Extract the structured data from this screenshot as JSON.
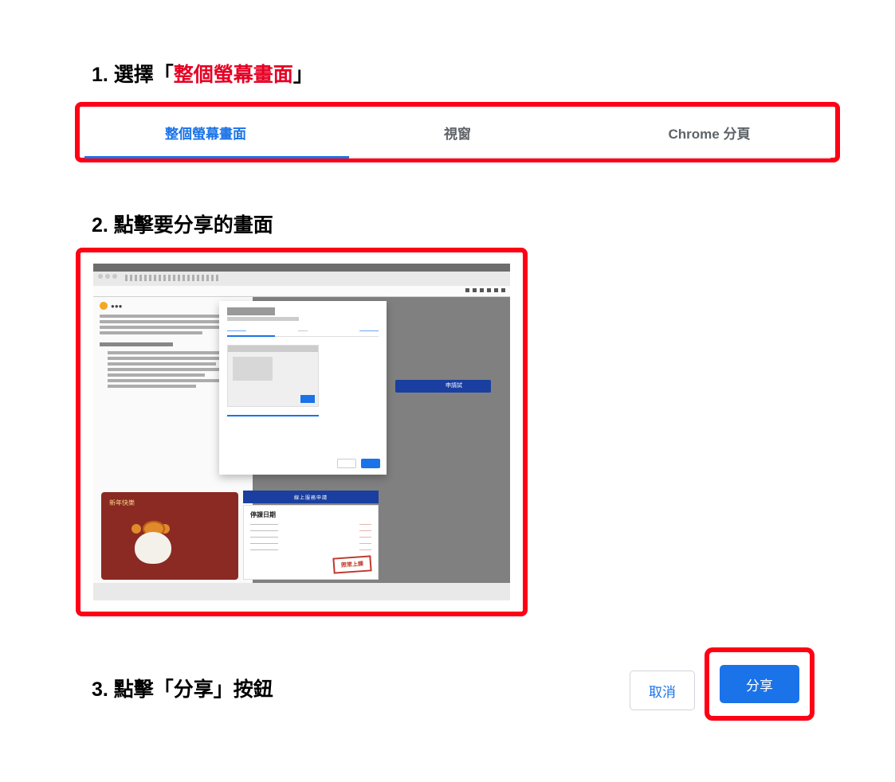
{
  "step1": {
    "prefix": "1.  選擇「",
    "highlight": "整個螢幕畫面",
    "suffix": "」"
  },
  "tabs": {
    "active": "整個螢幕畫面",
    "window": "視窗",
    "chrome_tab": "Chrome 分頁"
  },
  "step2": {
    "text": "2.  點擊要分享的畫面"
  },
  "preview": {
    "greeting": "新年快樂",
    "right_button": "申請試",
    "blue_strip": "線上服務申請",
    "notice_title": "停課日期",
    "stamp": "照常上課"
  },
  "step3": {
    "text": "3.  點擊「分享」按鈕"
  },
  "buttons": {
    "cancel": "取消",
    "share": "分享"
  }
}
